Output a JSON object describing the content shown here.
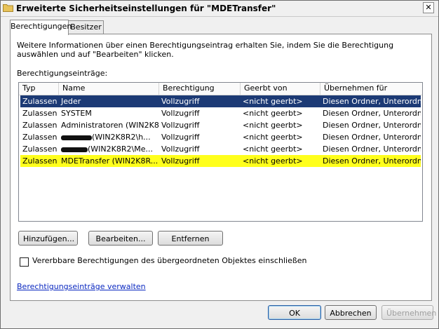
{
  "window": {
    "title": "Erweiterte Sicherheitseinstellungen für \"MDETransfer\"",
    "close_glyph": "✕"
  },
  "tabs": [
    {
      "label": "Berechtigungen",
      "active": true
    },
    {
      "label": "Besitzer",
      "active": false
    }
  ],
  "info_text": "Weitere Informationen über einen Berechtigungseintrag erhalten Sie, indem Sie die Berechtigung auswählen und auf \"Bearbeiten\" klicken.",
  "entries_label": "Berechtigungseinträge:",
  "table": {
    "columns": [
      "Typ",
      "Name",
      "Berechtigung",
      "Geerbt von",
      "Übernehmen für"
    ],
    "rows": [
      {
        "typ": "Zulassen",
        "name": "Jeder",
        "berechtigung": "Vollzugriff",
        "geerbt": "<nicht geerbt>",
        "uebernehmen": "Diesen Ordner, Unterordn...",
        "selected": true
      },
      {
        "typ": "Zulassen",
        "name": "SYSTEM",
        "berechtigung": "Vollzugriff",
        "geerbt": "<nicht geerbt>",
        "uebernehmen": "Diesen Ordner, Unterordn..."
      },
      {
        "typ": "Zulassen",
        "name": "Administratoren (WIN2K8...",
        "berechtigung": "Vollzugriff",
        "geerbt": "<nicht geerbt>",
        "uebernehmen": "Diesen Ordner, Unterordn..."
      },
      {
        "typ": "Zulassen",
        "name": "(WIN2K8R2\\h...",
        "berechtigung": "Vollzugriff",
        "geerbt": "<nicht geerbt>",
        "uebernehmen": "Diesen Ordner, Unterordn...",
        "redacted": true
      },
      {
        "typ": "Zulassen",
        "name": "(WIN2K8R2\\Me...",
        "berechtigung": "Vollzugriff",
        "geerbt": "<nicht geerbt>",
        "uebernehmen": "Diesen Ordner, Unterordn...",
        "redacted": true
      },
      {
        "typ": "Zulassen",
        "name": "MDETransfer (WIN2K8R...",
        "berechtigung": "Vollzugriff",
        "geerbt": "<nicht geerbt>",
        "uebernehmen": "Diesen Ordner, Unterordn...",
        "highlight": true
      }
    ]
  },
  "buttons": {
    "add": "Hinzufügen...",
    "edit": "Bearbeiten...",
    "remove": "Entfernen",
    "ok": "OK",
    "cancel": "Abbrechen",
    "apply": "Übernehmen"
  },
  "inherit_checkbox_label": "Vererbbare Berechtigungen des übergeordneten Objektes einschließen",
  "inherit_checked": false,
  "manage_link": "Berechtigungseinträge verwalten",
  "colors": {
    "selection": "#1c3a75",
    "highlight": "#ffff1c",
    "link": "#0a28c0"
  }
}
